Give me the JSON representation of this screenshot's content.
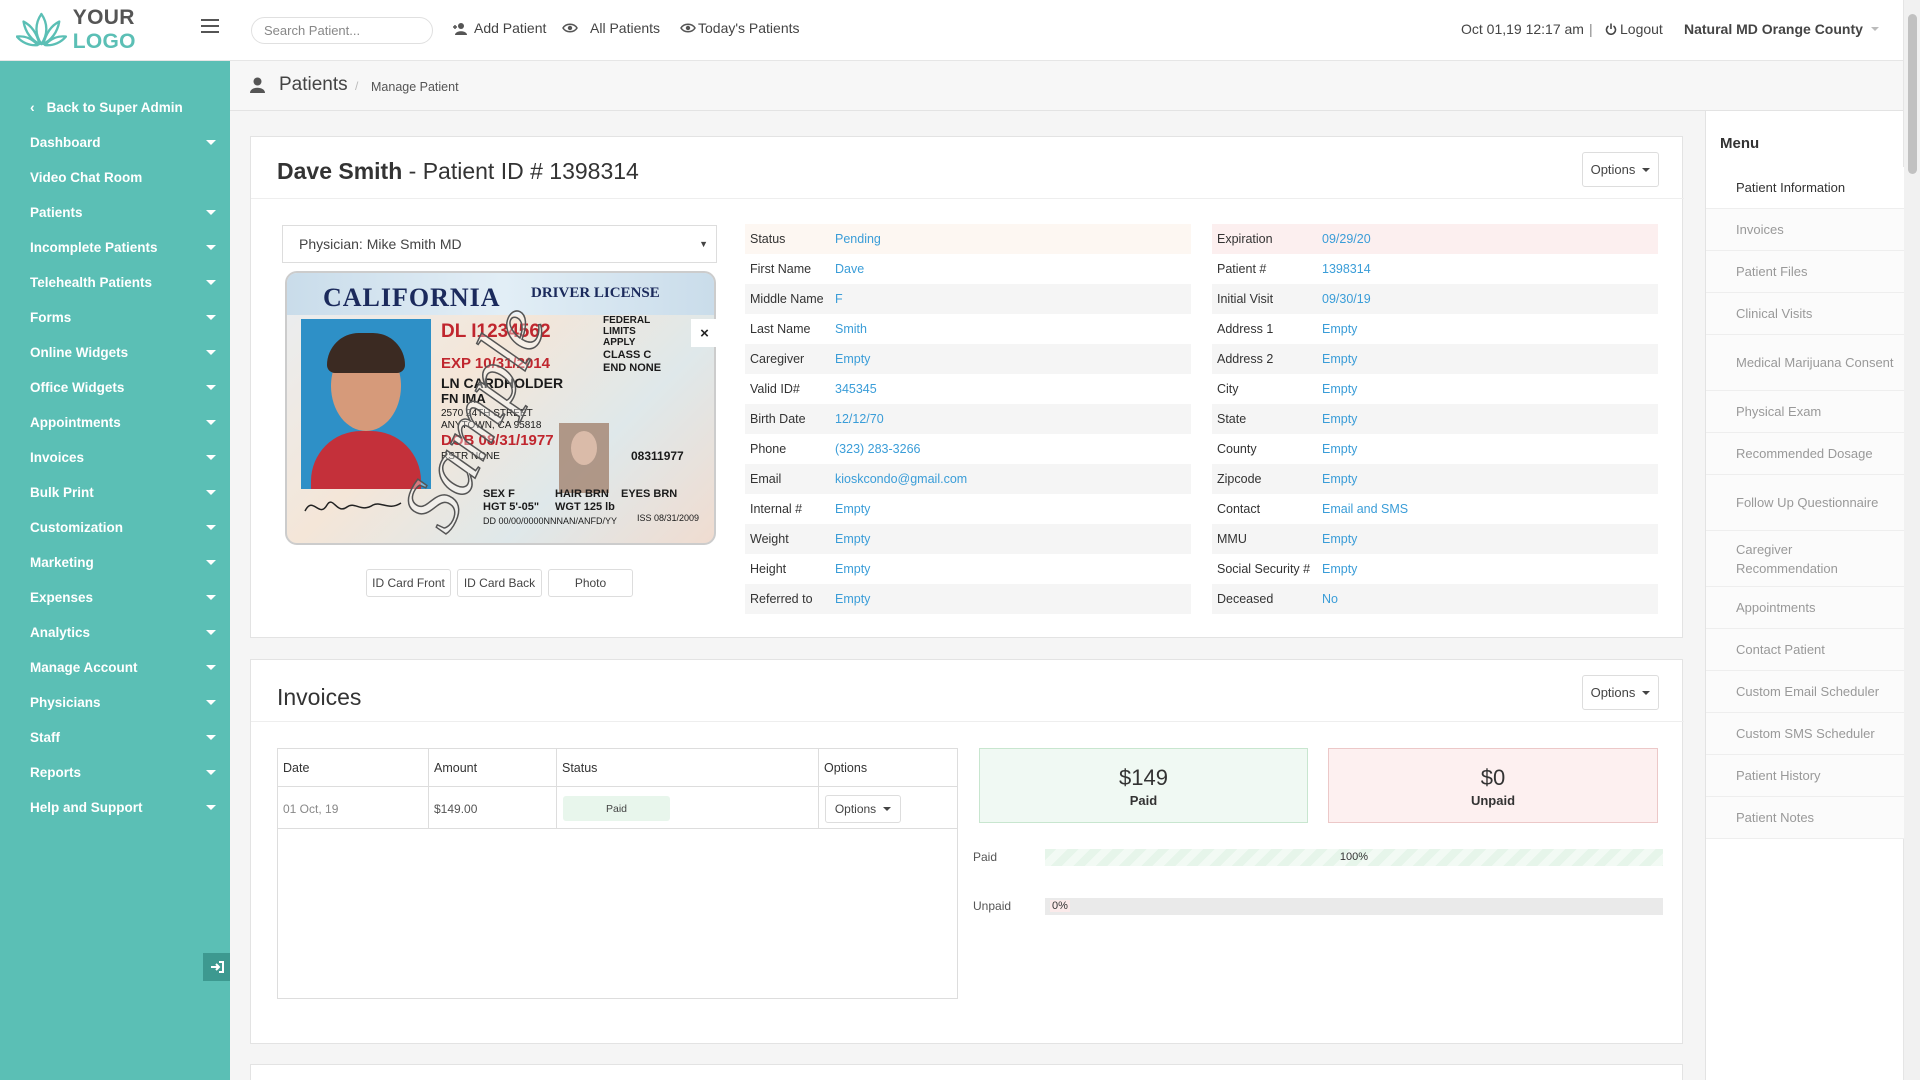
{
  "header": {
    "logo_text_1": "YOUR",
    "logo_text_2": "LOGO",
    "search_placeholder": "Search Patient...",
    "add_patient": "Add Patient",
    "all_patients": "All Patients",
    "todays_patients": "Today's Patients",
    "datetime": "Oct 01,19 12:17 am",
    "separator": "|",
    "logout": "Logout",
    "clinic": "Natural MD Orange County"
  },
  "sidebar": {
    "back": "Back to Super Admin",
    "items": [
      {
        "label": "Dashboard",
        "has_caret": true
      },
      {
        "label": "Video Chat Room",
        "has_caret": false
      },
      {
        "label": "Patients",
        "has_caret": true
      },
      {
        "label": "Incomplete Patients",
        "has_caret": true
      },
      {
        "label": "Telehealth Patients",
        "has_caret": true
      },
      {
        "label": "Forms",
        "has_caret": true
      },
      {
        "label": "Online Widgets",
        "has_caret": true
      },
      {
        "label": "Office Widgets",
        "has_caret": true
      },
      {
        "label": "Appointments",
        "has_caret": true
      },
      {
        "label": "Invoices",
        "has_caret": true
      },
      {
        "label": "Bulk Print",
        "has_caret": true
      },
      {
        "label": "Customization",
        "has_caret": true
      },
      {
        "label": "Marketing",
        "has_caret": true
      },
      {
        "label": "Expenses",
        "has_caret": true
      },
      {
        "label": "Analytics",
        "has_caret": true
      },
      {
        "label": "Manage Account",
        "has_caret": true
      },
      {
        "label": "Physicians",
        "has_caret": true
      },
      {
        "label": "Staff",
        "has_caret": true
      },
      {
        "label": "Reports",
        "has_caret": true
      },
      {
        "label": "Help and Support",
        "has_caret": true
      }
    ]
  },
  "breadcrumb": {
    "title": "Patients",
    "separator": "/",
    "sub": "Manage Patient"
  },
  "patient": {
    "name": "Dave Smith",
    "id_label": " - Patient ID # 1398314",
    "options": "Options",
    "physician_select": "Physician: Mike Smith MD",
    "id_card": {
      "state": "CALIFORNIA",
      "type": "DRIVER LICENSE",
      "dl": "DL I1234562",
      "exp": "EXP 10/31/2014",
      "ln": "LN CARDHOLDER",
      "fn": "FN IMA",
      "street": "2570 24TH STREET",
      "city": "ANYTOWN, CA 95818",
      "dob": "DOB 08/31/1977",
      "sex": "SEX F",
      "hgt": "HGT 5'-05\"",
      "hair": "HAIR BRN",
      "wgt": "WGT 125 lb",
      "eyes": "EYES BRN",
      "watermark": "Sample",
      "number": "08311977",
      "iss": "ISS 08/31/2009",
      "federal": "FEDERAL LIMITS APPLY",
      "class": "CLASS C",
      "end": "END NONE",
      "rstr": "RSTR NONE",
      "dd": "DD 00/00/0000NNNAN/ANFD/YY"
    },
    "card_buttons": [
      "ID Card Front",
      "ID Card Back",
      "Photo"
    ],
    "left_fields": [
      {
        "label": "Status",
        "value": "Pending"
      },
      {
        "label": "First Name",
        "value": "Dave"
      },
      {
        "label": "Middle Name",
        "value": "F"
      },
      {
        "label": "Last Name",
        "value": "Smith"
      },
      {
        "label": "Caregiver",
        "value": "Empty"
      },
      {
        "label": "Valid ID#",
        "value": "345345"
      },
      {
        "label": "Birth Date",
        "value": "12/12/70"
      },
      {
        "label": "Phone",
        "value": "(323) 283-3266"
      },
      {
        "label": "Email",
        "value": "kioskcondo@gmail.com"
      },
      {
        "label": "Internal #",
        "value": "Empty"
      },
      {
        "label": "Weight",
        "value": "Empty"
      },
      {
        "label": "Height",
        "value": "Empty"
      },
      {
        "label": "Referred to",
        "value": "Empty"
      }
    ],
    "right_fields": [
      {
        "label": "Expiration",
        "value": "09/29/20"
      },
      {
        "label": "Patient #",
        "value": "1398314"
      },
      {
        "label": "Initial Visit",
        "value": "09/30/19"
      },
      {
        "label": "Address 1",
        "value": "Empty"
      },
      {
        "label": "Address 2",
        "value": "Empty"
      },
      {
        "label": "City",
        "value": "Empty"
      },
      {
        "label": "State",
        "value": "Empty"
      },
      {
        "label": "County",
        "value": "Empty"
      },
      {
        "label": "Zipcode",
        "value": "Empty"
      },
      {
        "label": "Contact",
        "value": "Email and SMS"
      },
      {
        "label": "MMU",
        "value": "Empty"
      },
      {
        "label": "Social Security #",
        "value": "Empty"
      },
      {
        "label": "Deceased",
        "value": "No"
      }
    ],
    "status_highlight": "#fdf7f2",
    "expiration_highlight": "#fcefef"
  },
  "invoices": {
    "title": "Invoices",
    "options": "Options",
    "columns": [
      "Date",
      "Amount",
      "Status",
      "Options"
    ],
    "rows": [
      {
        "date": "01 Oct, 19",
        "amount": "$149.00",
        "status": "Paid",
        "options": "Options"
      }
    ],
    "paid_total": "$149",
    "paid_label": "Paid",
    "unpaid_total": "$0",
    "unpaid_label": "Unpaid",
    "bar_paid_label": "Paid",
    "bar_paid_pct_text": "100%",
    "bar_paid_fraction": 1.0,
    "bar_unpaid_label": "Unpaid",
    "bar_unpaid_pct_text": "0%",
    "bar_unpaid_fraction": 0.0
  },
  "right_menu": {
    "title": "Menu",
    "items": [
      "Patient Information",
      "Invoices",
      "Patient Files",
      "Clinical Visits",
      "Medical Marijuana Consent",
      "Physical Exam",
      "Recommended Dosage",
      "Follow Up Questionnaire",
      "Caregiver Recommendation",
      "Appointments",
      "Contact Patient",
      "Custom Email Scheduler",
      "Custom SMS Scheduler",
      "Patient History",
      "Patient Notes"
    ],
    "active_index": 0
  },
  "colors": {
    "accent": "#5bbfb5",
    "link": "#3a9dd8",
    "paid_bg": "#f0f9f3",
    "unpaid_bg": "#fdf0f0"
  }
}
